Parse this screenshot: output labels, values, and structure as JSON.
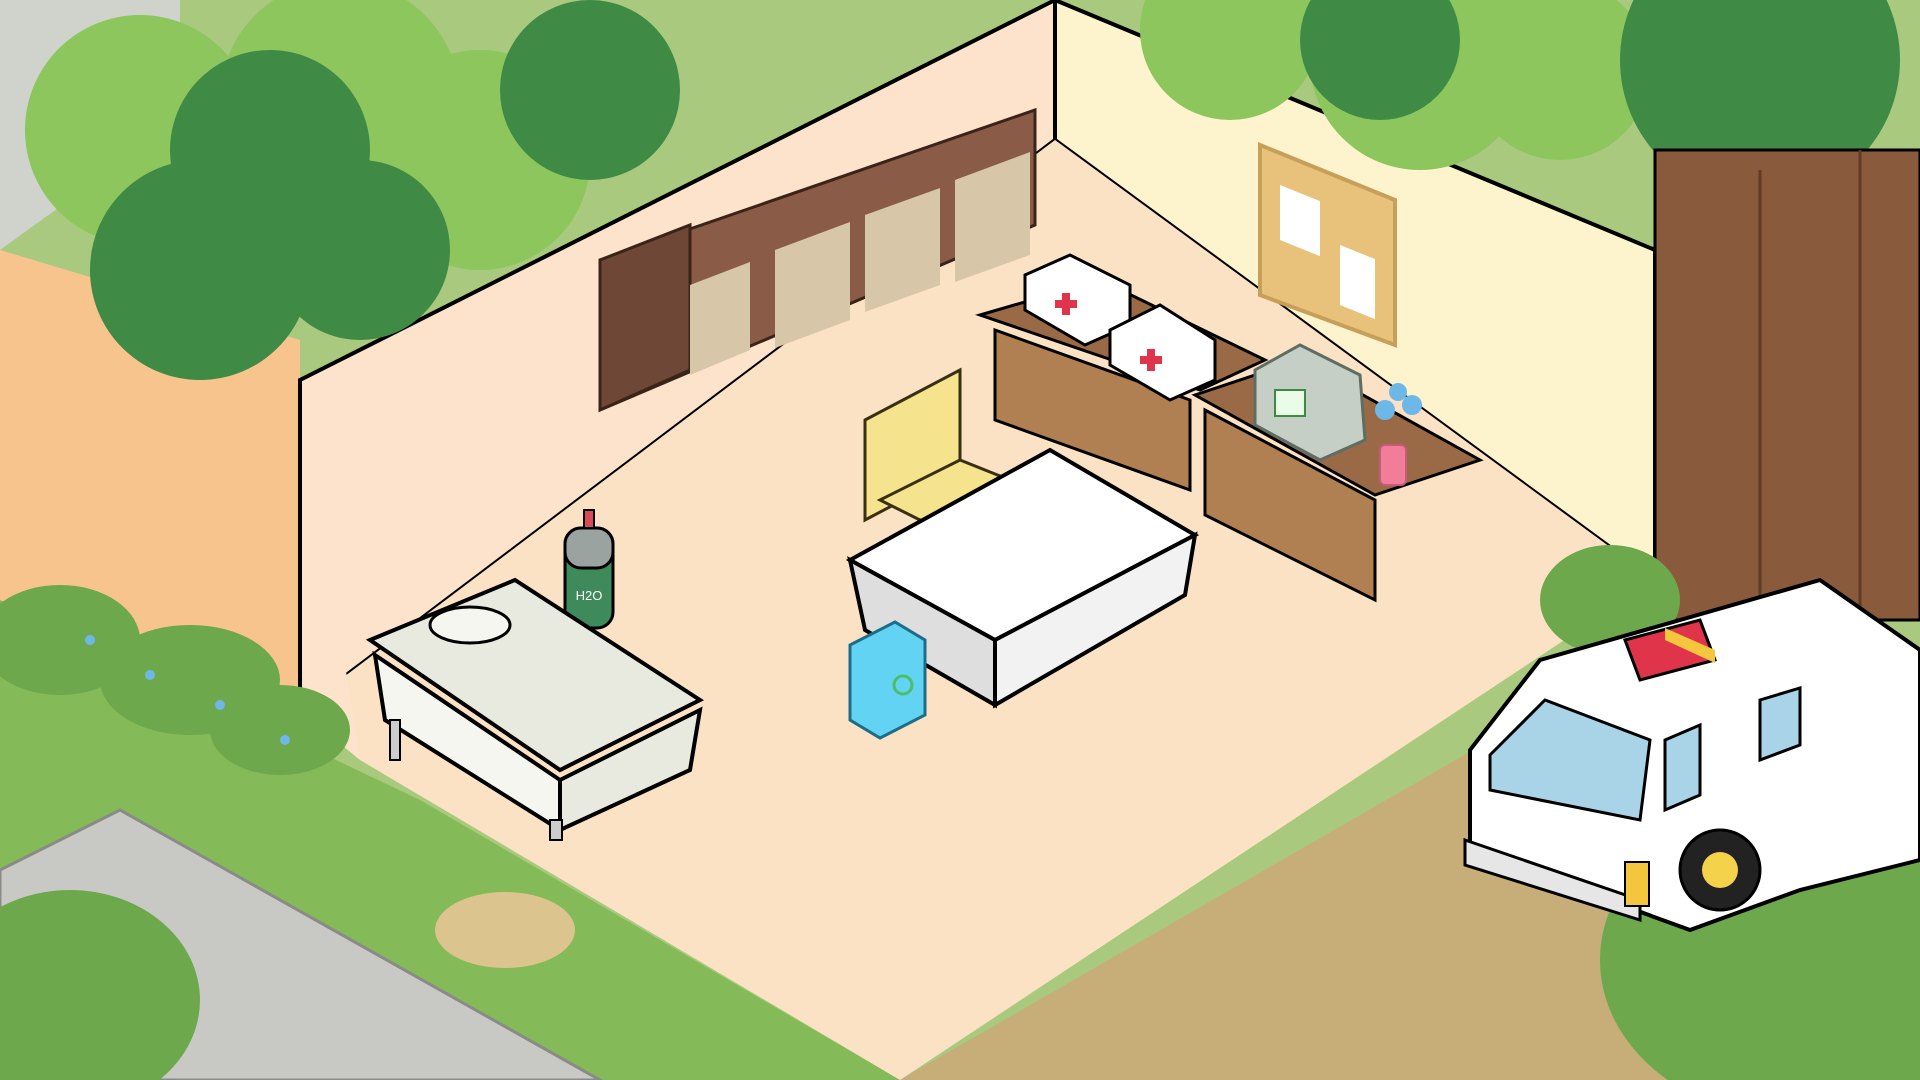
{
  "scene": {
    "room": "medical-station",
    "oxygen_tank": {
      "label": "H2O"
    },
    "colors": {
      "grass": "#8fc162",
      "floor": "#fbe2c4",
      "wall_left": "#fde3cb",
      "wall_right": "#fdf3cd",
      "tree_dark": "#3f8a45",
      "tree_light": "#8cc65d",
      "shelf_wood": "#8a5c48",
      "desk_wood": "#9a6a46",
      "ambulance_body": "#ffffff",
      "ambulance_light": "#e0344a",
      "flower": "#6db8e6",
      "recycle_bin": "#62d3f3"
    },
    "objects": [
      "bookshelf-unit",
      "notice-board",
      "first-aid-kit",
      "desk",
      "medical-monitor",
      "flower-vase",
      "chair",
      "exam-table",
      "hospital-bed",
      "oxygen-tank",
      "recycle-bin",
      "ambulance"
    ]
  }
}
